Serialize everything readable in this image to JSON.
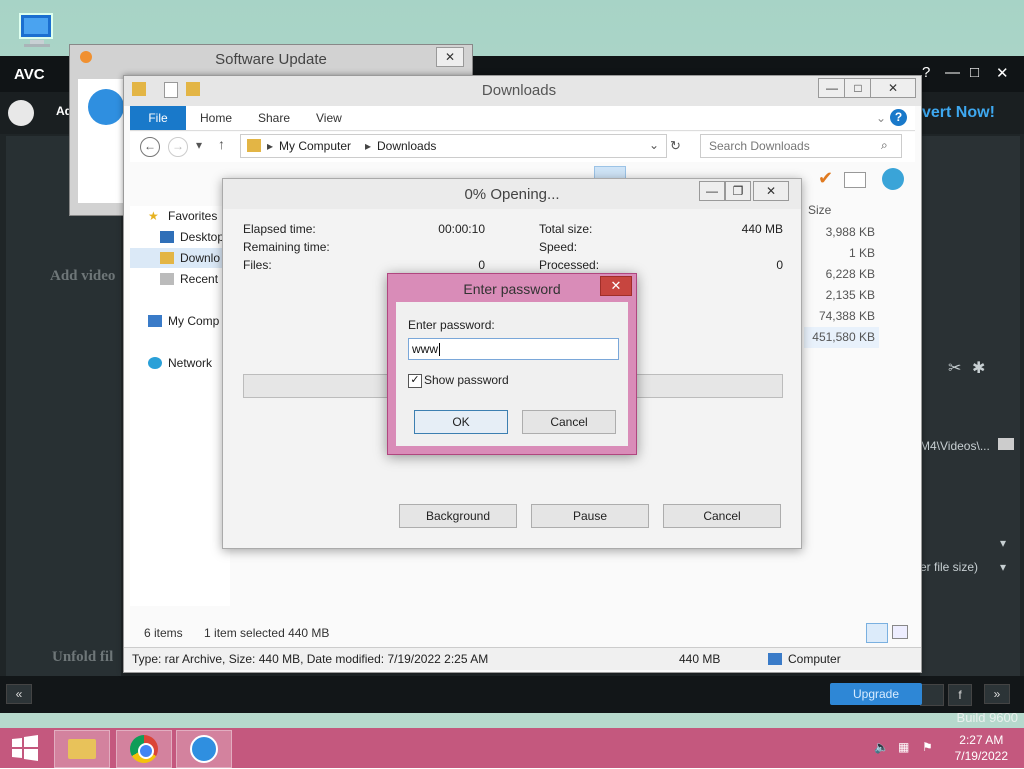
{
  "desktop": {
    "build_text": "Build 9600"
  },
  "avc": {
    "logo": "AVC",
    "convert_label": "vert Now!",
    "add_video_hint": "Add video",
    "add_label": "Ad",
    "unfold_hint": "Unfold fil",
    "path_text": "M4\\Videos\\...",
    "size_option": "er file size)",
    "upgrade_label": "Upgrade",
    "window_controls": [
      "?",
      "—",
      "□",
      "✕"
    ]
  },
  "software_update": {
    "title": "Software Update",
    "close": "✕"
  },
  "explorer": {
    "title": "Downloads",
    "tabs": [
      "File",
      "Home",
      "Share",
      "View"
    ],
    "breadcrumb": [
      "My Computer",
      "Downloads"
    ],
    "search_placeholder": "Search Downloads",
    "nav": {
      "favorites": "Favorites",
      "desktop": "Desktop",
      "downloads": "Downlo",
      "recent": "Recent p",
      "my_computer": "My Comp",
      "network": "Network"
    },
    "size_header": "Size",
    "sizes": [
      "3,988 KB",
      "1 KB",
      "6,228 KB",
      "2,135 KB",
      "74,388 KB",
      "451,580 KB"
    ],
    "status_items": "6 items",
    "status_selected": "1 item selected  440 MB",
    "details": "Type: rar Archive, Size: 440 MB, Date modified: 7/19/2022 2:25 AM",
    "details_size": "440 MB",
    "details_location": "Computer"
  },
  "opening": {
    "title": "0% Opening...",
    "elapsed_label": "Elapsed time:",
    "elapsed_value": "00:00:10",
    "remaining_label": "Remaining time:",
    "files_label": "Files:",
    "files_value": "0",
    "total_label": "Total size:",
    "total_value": "440 MB",
    "speed_label": "Speed:",
    "processed_label": "Processed:",
    "processed_value": "0",
    "progress": 0,
    "buttons": {
      "background": "Background",
      "pause": "Pause",
      "cancel": "Cancel"
    }
  },
  "password": {
    "title": "Enter password",
    "label": "Enter password:",
    "value": "www",
    "show_password_label": "Show password",
    "show_password_checked": true,
    "ok": "OK",
    "cancel": "Cancel"
  },
  "taskbar": {
    "time": "2:27 AM",
    "date": "7/19/2022",
    "apps": [
      "start-icon",
      "file-explorer-icon",
      "chrome-icon",
      "avc-icon"
    ]
  }
}
